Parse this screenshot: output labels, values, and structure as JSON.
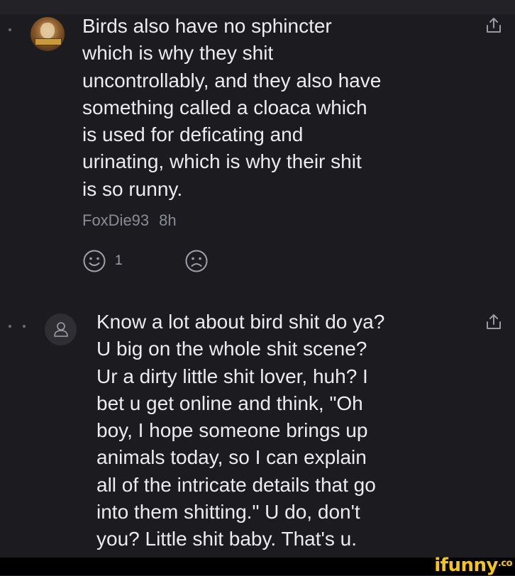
{
  "comments": [
    {
      "text": "Birds also have no sphincter\nwhich is why they shit\nuncontrollably, and they also have\nsomething called a cloaca which\nis used for deficating and\nurinating, which is why their shit\nis so runny.",
      "username": "FoxDie93",
      "time": "8h",
      "upvote_count": "1"
    },
    {
      "text": "Know a lot about bird shit do ya?\nU big on the whole shit scene?\nUr a dirty little shit lover, huh? I\nbet u get online and think, \"Oh\nboy, I hope someone brings up\nanimals today, so I can explain\nall of the intricate details that go\ninto them shitting.\" U do, don't\nyou? Little shit baby. That's u."
    }
  ],
  "watermark": {
    "brand": "ifunny",
    "suffix": ".co"
  },
  "colors": {
    "background": "#1c1c20",
    "text": "#ececf0",
    "meta": "#8c8c94",
    "brand": "#f7c51a"
  }
}
